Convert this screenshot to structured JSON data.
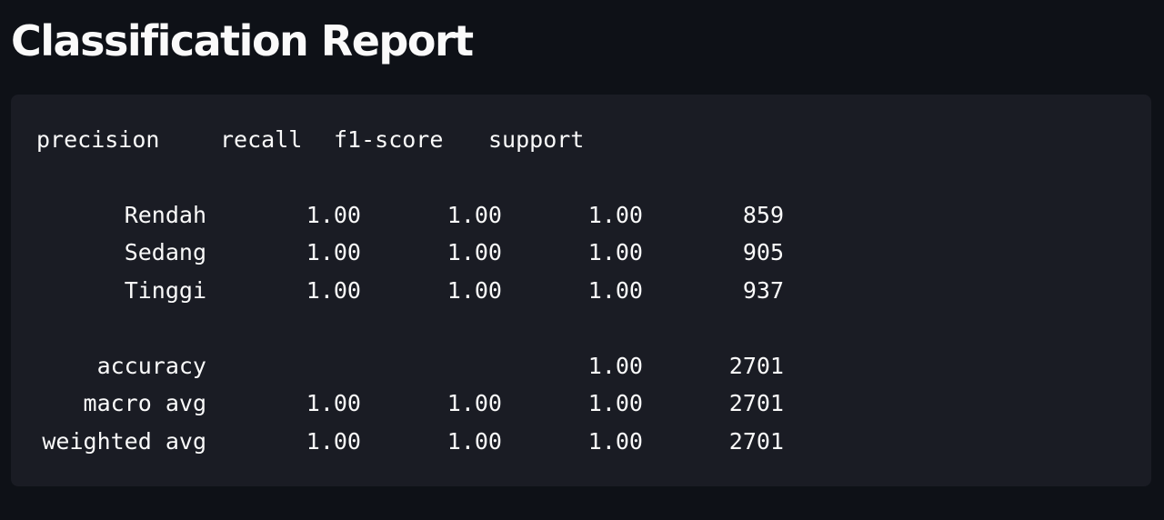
{
  "page": {
    "title": "Classification Report"
  },
  "report": {
    "headers": {
      "precision": "precision",
      "recall": "recall",
      "f1": "f1-score",
      "support": "support"
    },
    "rows": [
      {
        "label": "Rendah",
        "precision": "1.00",
        "recall": "1.00",
        "f1": "1.00",
        "support": "859"
      },
      {
        "label": "Sedang",
        "precision": "1.00",
        "recall": "1.00",
        "f1": "1.00",
        "support": "905"
      },
      {
        "label": "Tinggi",
        "precision": "1.00",
        "recall": "1.00",
        "f1": "1.00",
        "support": "937"
      },
      {
        "label": "accuracy",
        "precision": "",
        "recall": "",
        "f1": "1.00",
        "support": "2701"
      },
      {
        "label": "macro avg",
        "precision": "1.00",
        "recall": "1.00",
        "f1": "1.00",
        "support": "2701"
      },
      {
        "label": "weighted avg",
        "precision": "1.00",
        "recall": "1.00",
        "f1": "1.00",
        "support": "2701"
      }
    ]
  },
  "colors": {
    "background": "#0e1117",
    "code_background": "#1a1c24",
    "text": "#fafafa"
  }
}
